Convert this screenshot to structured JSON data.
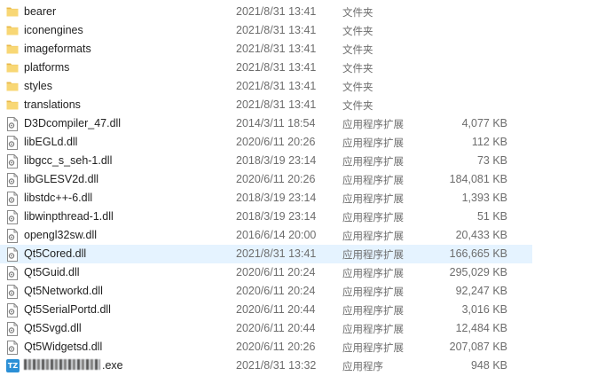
{
  "files": [
    {
      "name": "bearer",
      "date": "2021/8/31 13:41",
      "type": "文件夹",
      "size": "",
      "icon": "folder-icon"
    },
    {
      "name": "iconengines",
      "date": "2021/8/31 13:41",
      "type": "文件夹",
      "size": "",
      "icon": "folder-icon"
    },
    {
      "name": "imageformats",
      "date": "2021/8/31 13:41",
      "type": "文件夹",
      "size": "",
      "icon": "folder-icon"
    },
    {
      "name": "platforms",
      "date": "2021/8/31 13:41",
      "type": "文件夹",
      "size": "",
      "icon": "folder-icon"
    },
    {
      "name": "styles",
      "date": "2021/8/31 13:41",
      "type": "文件夹",
      "size": "",
      "icon": "folder-icon"
    },
    {
      "name": "translations",
      "date": "2021/8/31 13:41",
      "type": "文件夹",
      "size": "",
      "icon": "folder-icon"
    },
    {
      "name": "D3Dcompiler_47.dll",
      "date": "2014/3/11 18:54",
      "type": "应用程序扩展",
      "size": "4,077 KB",
      "icon": "dll-file-icon"
    },
    {
      "name": "libEGLd.dll",
      "date": "2020/6/11 20:26",
      "type": "应用程序扩展",
      "size": "112 KB",
      "icon": "dll-file-icon"
    },
    {
      "name": "libgcc_s_seh-1.dll",
      "date": "2018/3/19 23:14",
      "type": "应用程序扩展",
      "size": "73 KB",
      "icon": "dll-file-icon"
    },
    {
      "name": "libGLESV2d.dll",
      "date": "2020/6/11 20:26",
      "type": "应用程序扩展",
      "size": "184,081 KB",
      "icon": "dll-file-icon"
    },
    {
      "name": "libstdc++-6.dll",
      "date": "2018/3/19 23:14",
      "type": "应用程序扩展",
      "size": "1,393 KB",
      "icon": "dll-file-icon"
    },
    {
      "name": "libwinpthread-1.dll",
      "date": "2018/3/19 23:14",
      "type": "应用程序扩展",
      "size": "51 KB",
      "icon": "dll-file-icon"
    },
    {
      "name": "opengl32sw.dll",
      "date": "2016/6/14 20:00",
      "type": "应用程序扩展",
      "size": "20,433 KB",
      "icon": "dll-file-icon"
    },
    {
      "name": "Qt5Cored.dll",
      "date": "2021/8/31 13:41",
      "type": "应用程序扩展",
      "size": "166,665 KB",
      "icon": "dll-file-icon",
      "selected": true
    },
    {
      "name": "Qt5Guid.dll",
      "date": "2020/6/11 20:24",
      "type": "应用程序扩展",
      "size": "295,029 KB",
      "icon": "dll-file-icon"
    },
    {
      "name": "Qt5Networkd.dll",
      "date": "2020/6/11 20:24",
      "type": "应用程序扩展",
      "size": "92,247 KB",
      "icon": "dll-file-icon"
    },
    {
      "name": "Qt5SerialPortd.dll",
      "date": "2020/6/11 20:44",
      "type": "应用程序扩展",
      "size": "3,016 KB",
      "icon": "dll-file-icon"
    },
    {
      "name": "Qt5Svgd.dll",
      "date": "2020/6/11 20:44",
      "type": "应用程序扩展",
      "size": "12,484 KB",
      "icon": "dll-file-icon"
    },
    {
      "name": "Qt5Widgetsd.dll",
      "date": "2020/6/11 20:26",
      "type": "应用程序扩展",
      "size": "207,087 KB",
      "icon": "dll-file-icon"
    },
    {
      "name": ".exe",
      "date": "2021/8/31 13:32",
      "type": "应用程序",
      "size": "948 KB",
      "icon": "exe-app-icon",
      "redacted_prefix": true,
      "badge": "TZ"
    }
  ],
  "colors": {
    "folder": "#f8d775",
    "folder_dark": "#e8b84a",
    "selected_row": "#e5f3ff",
    "secondary_text": "#6d6d6d",
    "exe_badge": "#2b8fd6"
  }
}
